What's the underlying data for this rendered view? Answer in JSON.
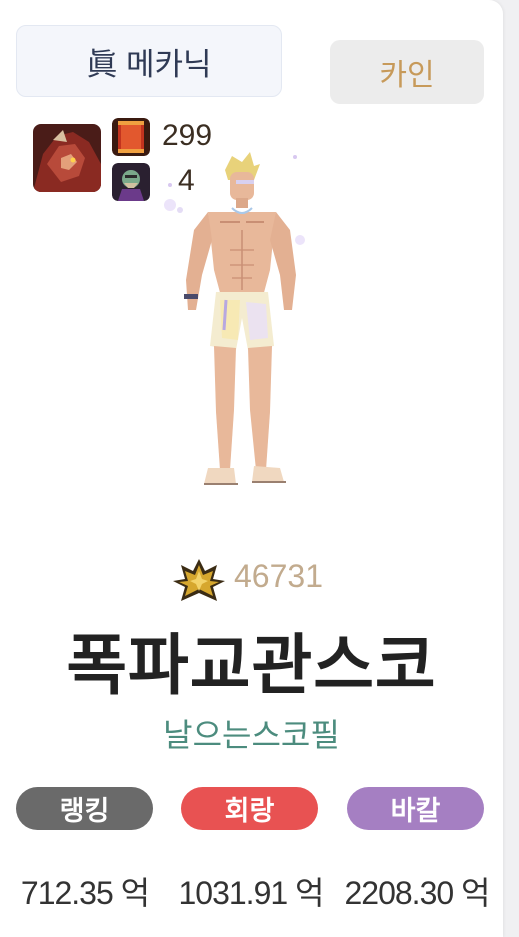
{
  "header": {
    "job_label": "眞 메카닉",
    "server_label": "카인"
  },
  "stats": [
    {
      "icon": "red-scroll-icon",
      "value": "299"
    },
    {
      "icon": "portrait-icon",
      "value": "4"
    }
  ],
  "profile": {
    "fame_icon": "gold-emblem-icon",
    "fame_value": "46731",
    "character_name": "폭파교관스코",
    "guild_name": "날으는스코필"
  },
  "categories": [
    {
      "label": "랭킹",
      "color": "#6a6a6a",
      "amount": "712.35 억"
    },
    {
      "label": "회랑",
      "color": "#e85252",
      "amount": "1031.91 억"
    },
    {
      "label": "바칼",
      "color": "#a57fc2",
      "amount": "2208.30 억"
    }
  ]
}
